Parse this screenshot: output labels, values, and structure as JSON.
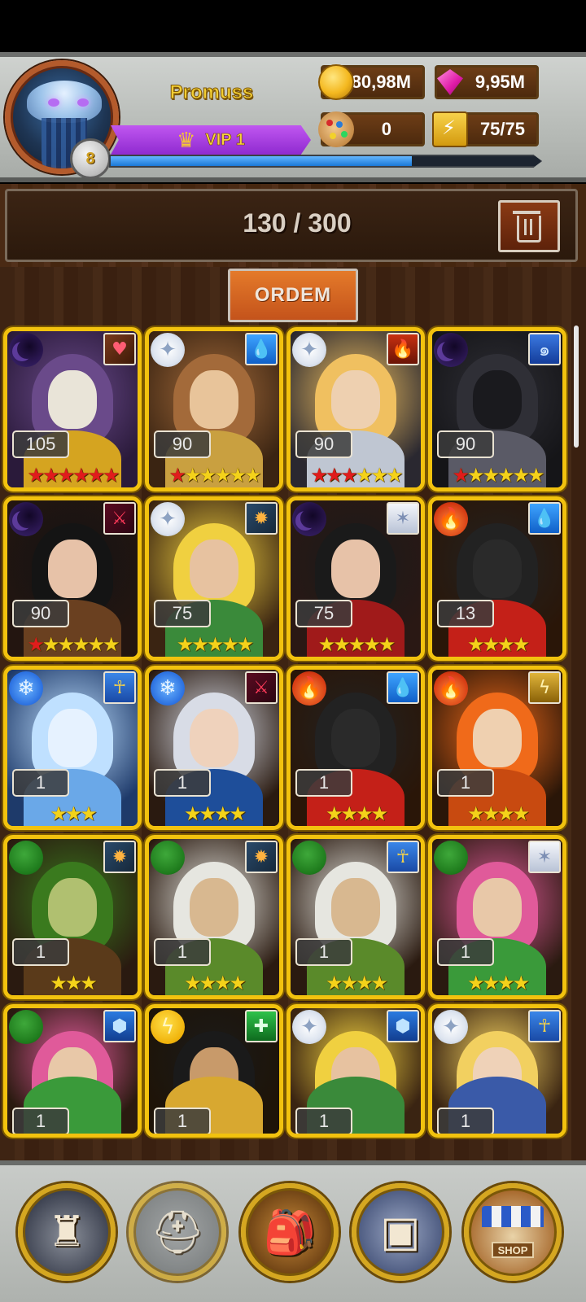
{
  "player": {
    "name": "Promuss",
    "level": "8",
    "vip_label": "VIP 1",
    "xp_progress": 0.7
  },
  "resources": {
    "coins": "80,98M",
    "gems": "9,95M",
    "paint": "0",
    "energy": "75/75"
  },
  "inventory": {
    "count": "130 / 300"
  },
  "toolbar": {
    "sort_label": "ORDEM"
  },
  "heroes": [
    {
      "element": "dark",
      "class": "heart",
      "level": "105",
      "red_stars": 6,
      "gold_stars": 0,
      "palette": [
        "#2a1a3a",
        "#6a4a8a",
        "#e9e4d8",
        "#d5a420"
      ]
    },
    {
      "element": "light",
      "class": "water",
      "level": "90",
      "red_stars": 1,
      "gold_stars": 5,
      "palette": [
        "#3a2412",
        "#a36a3a",
        "#e8c49a",
        "#c9a040"
      ]
    },
    {
      "element": "light",
      "class": "flame",
      "level": "90",
      "red_stars": 3,
      "gold_stars": 3,
      "palette": [
        "#2a2830",
        "#f0c060",
        "#eed0b0",
        "#bfc6d2"
      ]
    },
    {
      "element": "dark",
      "class": "vortex",
      "level": "90",
      "red_stars": 1,
      "gold_stars": 5,
      "palette": [
        "#151518",
        "#2f2f36",
        "#1a1a1e",
        "#5a5a66"
      ]
    },
    {
      "element": "dark",
      "class": "sword",
      "level": "90",
      "red_stars": 1,
      "gold_stars": 5,
      "palette": [
        "#231510",
        "#141414",
        "#e7c2a8",
        "#6a4020"
      ]
    },
    {
      "element": "light",
      "class": "burst",
      "level": "75",
      "red_stars": 0,
      "gold_stars": 5,
      "palette": [
        "#3a2412",
        "#f0d040",
        "#e7c2a0",
        "#3a8a3a"
      ]
    },
    {
      "element": "dark",
      "class": "star",
      "level": "75",
      "red_stars": 0,
      "gold_stars": 5,
      "palette": [
        "#2a1814",
        "#1a1a1a",
        "#e7c2a8",
        "#a01a1a"
      ]
    },
    {
      "element": "fire",
      "class": "water",
      "level": "13",
      "red_stars": 0,
      "gold_stars": 4,
      "palette": [
        "#2a1608",
        "#222",
        "#2a2a2a",
        "#c42018"
      ]
    },
    {
      "element": "ice",
      "class": "ankh",
      "level": "1",
      "red_stars": 0,
      "gold_stars": 3,
      "palette": [
        "#1e3a6a",
        "#bfe0ff",
        "#e6f2ff",
        "#6aa8e8"
      ]
    },
    {
      "element": "ice",
      "class": "sword",
      "level": "1",
      "red_stars": 0,
      "gold_stars": 4,
      "palette": [
        "#2a1a10",
        "#d8dce6",
        "#efd2bc",
        "#1e4e9a"
      ]
    },
    {
      "element": "fire",
      "class": "water",
      "level": "1",
      "red_stars": 0,
      "gold_stars": 4,
      "palette": [
        "#2a1608",
        "#222",
        "#2a2a2a",
        "#c42018"
      ]
    },
    {
      "element": "fire",
      "class": "bolt",
      "level": "1",
      "red_stars": 0,
      "gold_stars": 4,
      "palette": [
        "#2a1608",
        "#f06a1a",
        "#efd0b0",
        "#c84a10"
      ]
    },
    {
      "element": "nature",
      "class": "burst",
      "level": "1",
      "red_stars": 0,
      "gold_stars": 3,
      "palette": [
        "#2a1a10",
        "#3a7a1e",
        "#b0c070",
        "#5a3a1a"
      ]
    },
    {
      "element": "nature",
      "class": "burst",
      "level": "1",
      "red_stars": 0,
      "gold_stars": 4,
      "palette": [
        "#2a1a10",
        "#e6e6e0",
        "#d8b890",
        "#5a8a2a"
      ]
    },
    {
      "element": "nature",
      "class": "ankh",
      "level": "1",
      "red_stars": 0,
      "gold_stars": 4,
      "palette": [
        "#2a1a10",
        "#e6e6e0",
        "#d8b890",
        "#5a8a2a"
      ]
    },
    {
      "element": "nature",
      "class": "star",
      "level": "1",
      "red_stars": 0,
      "gold_stars": 4,
      "palette": [
        "#2a1a10",
        "#e05a9a",
        "#e8c8a8",
        "#3a9a3a"
      ]
    },
    {
      "element": "nature",
      "class": "hex",
      "level": "1",
      "red_stars": 0,
      "gold_stars": 0,
      "palette": [
        "#2a1a10",
        "#e05a9a",
        "#e8c8a8",
        "#3a9a3a"
      ]
    },
    {
      "element": "thunder",
      "class": "cross",
      "level": "1",
      "red_stars": 0,
      "gold_stars": 0,
      "palette": [
        "#1e1408",
        "#1a1a1a",
        "#c89a6a",
        "#d8a830"
      ]
    },
    {
      "element": "light",
      "class": "hex",
      "level": "1",
      "red_stars": 0,
      "gold_stars": 0,
      "palette": [
        "#3a2412",
        "#f0d040",
        "#e7c2a0",
        "#3a8a3a"
      ]
    },
    {
      "element": "light",
      "class": "ankh",
      "level": "1",
      "red_stars": 0,
      "gold_stars": 0,
      "palette": [
        "#3a2412",
        "#f2d060",
        "#efd2b8",
        "#3a5aa8"
      ]
    }
  ],
  "nav": [
    {
      "id": "castle",
      "icon": "castle-icon"
    },
    {
      "id": "helmet",
      "icon": "helmet-icon"
    },
    {
      "id": "backpack",
      "icon": "backpack-icon"
    },
    {
      "id": "chest",
      "icon": "treasure-chest-icon"
    },
    {
      "id": "shop",
      "icon": "shop-stall-icon",
      "label": "SHOP"
    }
  ]
}
